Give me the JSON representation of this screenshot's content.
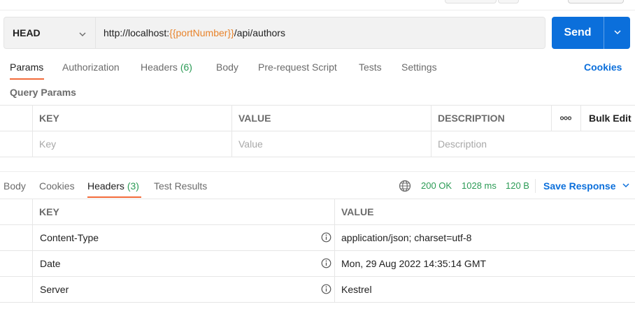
{
  "request": {
    "method": "HEAD",
    "url_prefix": "http://localhost:",
    "url_variable": "{{portNumber}}",
    "url_suffix": "/api/authors",
    "send_label": "Send"
  },
  "request_tabs": {
    "params": "Params",
    "authorization": "Authorization",
    "headers": "Headers",
    "headers_count": "(6)",
    "body": "Body",
    "prerequest": "Pre-request Script",
    "tests": "Tests",
    "settings": "Settings",
    "cookies": "Cookies"
  },
  "query_params": {
    "title": "Query Params",
    "columns": {
      "key": "KEY",
      "value": "VALUE",
      "description": "DESCRIPTION"
    },
    "more_label": "ooo",
    "bulk_edit": "Bulk Edit",
    "placeholders": {
      "key": "Key",
      "value": "Value",
      "description": "Description"
    }
  },
  "response_tabs": {
    "body": "Body",
    "cookies": "Cookies",
    "headers": "Headers",
    "headers_count": "(3)",
    "test_results": "Test Results"
  },
  "response_status": {
    "code": "200 OK",
    "time": "1028 ms",
    "size": "120 B",
    "save_response": "Save Response"
  },
  "response_headers": {
    "columns": {
      "key": "KEY",
      "value": "VALUE"
    },
    "rows": [
      {
        "key": "Content-Type",
        "value": "application/json; charset=utf-8"
      },
      {
        "key": "Date",
        "value": "Mon, 29 Aug 2022 14:35:14 GMT"
      },
      {
        "key": "Server",
        "value": "Kestrel"
      }
    ]
  },
  "colors": {
    "accent_blue": "#0b6fdb",
    "tab_underline": "#f26b3a",
    "status_green": "#2b9b55",
    "variable_orange": "#e8842c"
  }
}
